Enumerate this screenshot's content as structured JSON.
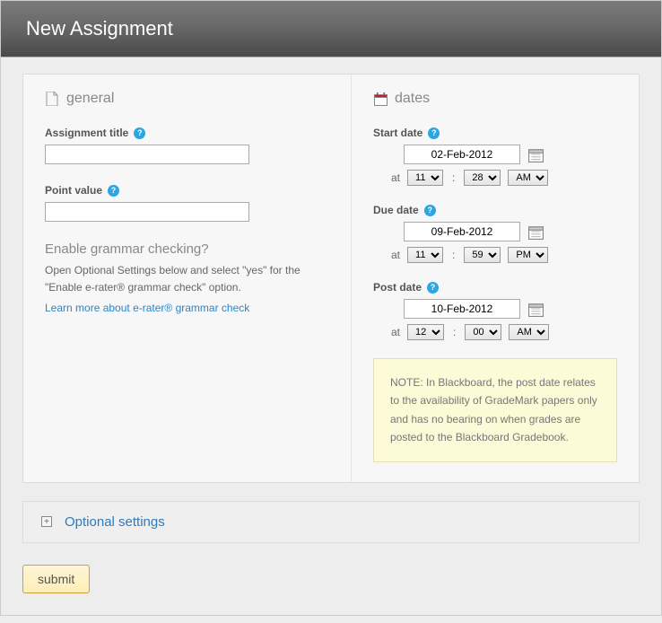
{
  "window_title": "New Assignment",
  "general": {
    "header": "general",
    "assignment_title_label": "Assignment title",
    "assignment_title_value": "",
    "point_value_label": "Point value",
    "point_value_value": "",
    "grammar_heading": "Enable grammar checking?",
    "grammar_help": "Open Optional Settings below and select \"yes\" for the \"Enable e-rater® grammar check\" option.",
    "grammar_link": "Learn more about e-rater® grammar check"
  },
  "dates": {
    "header": "dates",
    "at_label": "at",
    "start": {
      "label": "Start date",
      "date": "02-Feb-2012",
      "hour": "11",
      "minute": "28",
      "ampm": "AM"
    },
    "due": {
      "label": "Due date",
      "date": "09-Feb-2012",
      "hour": "11",
      "minute": "59",
      "ampm": "PM"
    },
    "post": {
      "label": "Post date",
      "date": "10-Feb-2012",
      "hour": "12",
      "minute": "00",
      "ampm": "AM"
    },
    "note_line1": "NOTE: In Blackboard, the post date relates to the availability of GradeMark papers only",
    "note_line2": "and has no bearing on when grades are posted to the Blackboard Gradebook."
  },
  "optional_label": "Optional settings",
  "submit_label": "submit"
}
